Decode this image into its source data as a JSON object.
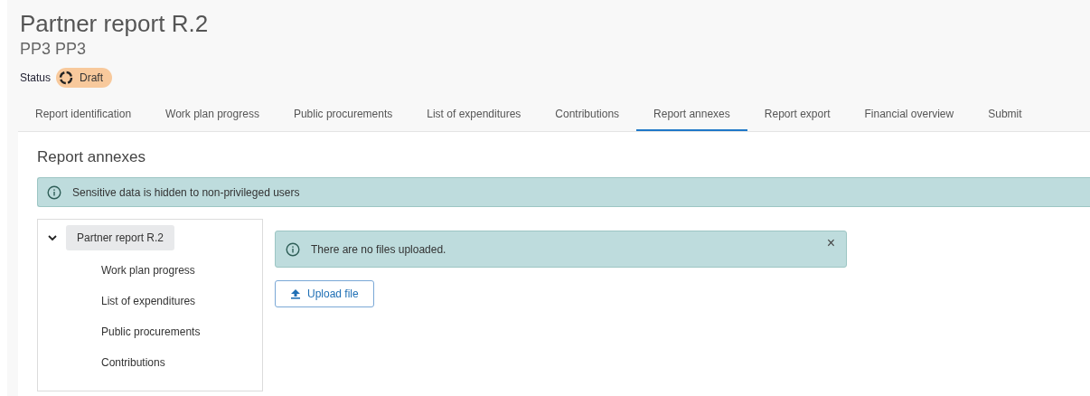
{
  "header": {
    "title": "Partner report R.2",
    "subtitle": "PP3 PP3",
    "status_label": "Status",
    "status": "Draft"
  },
  "tabs": [
    {
      "label": "Report identification",
      "selected": false
    },
    {
      "label": "Work plan progress",
      "selected": false
    },
    {
      "label": "Public procurements",
      "selected": false
    },
    {
      "label": "List of expenditures",
      "selected": false
    },
    {
      "label": "Contributions",
      "selected": false
    },
    {
      "label": "Report annexes",
      "selected": true
    },
    {
      "label": "Report export",
      "selected": false
    },
    {
      "label": "Financial overview",
      "selected": false
    },
    {
      "label": "Submit",
      "selected": false
    }
  ],
  "section": {
    "title": "Report annexes",
    "info": "Sensitive data is hidden to non-privileged users"
  },
  "tree": [
    {
      "label": "Partner report R.2",
      "selected": true,
      "expanded": true,
      "children": [
        {
          "label": "Work plan progress",
          "selected": false
        },
        {
          "label": "List of expenditures",
          "selected": false
        },
        {
          "label": "Public procurements",
          "selected": false
        },
        {
          "label": "Contributions",
          "selected": false
        }
      ]
    }
  ],
  "files_alert": {
    "message": "There are no files uploaded.",
    "close": "×"
  },
  "upload_button": "Upload file"
}
